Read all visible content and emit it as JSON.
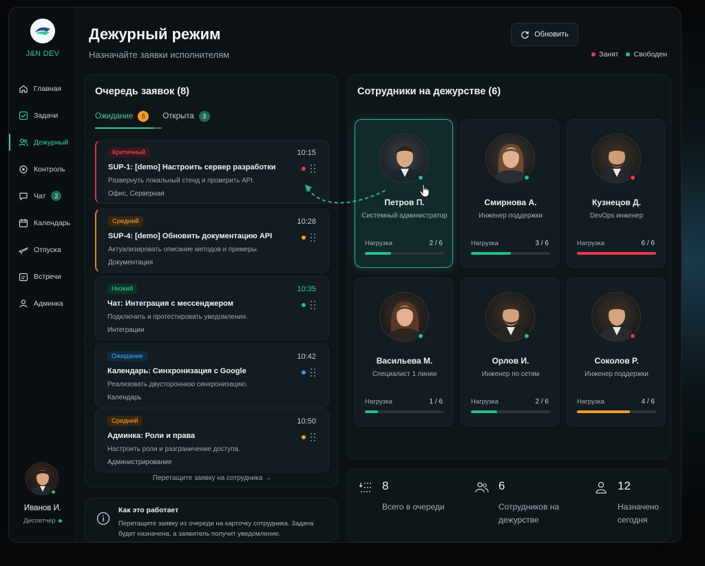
{
  "app": {
    "logo_text": "J&N DEV",
    "title": "Дежурный режим",
    "subtitle": "Назначайте заявки исполнителям",
    "refresh_label": "Обновить"
  },
  "legend": {
    "busy": "Занят",
    "free": "Свободен"
  },
  "colors": {
    "accent": "#2fd0a0",
    "busy": "#e5394e",
    "free": "#22c08f",
    "warning": "#f29b26",
    "info": "#3a9ae8"
  },
  "nav": [
    {
      "label": "Главная",
      "icon": "home-icon"
    },
    {
      "label": "Задачи",
      "icon": "checkbox-icon"
    },
    {
      "label": "Дежурный",
      "icon": "users-icon",
      "active": true
    },
    {
      "label": "Контроль",
      "icon": "control-icon"
    },
    {
      "label": "Чат",
      "icon": "chat-icon",
      "badge": "2"
    },
    {
      "label": "Календарь",
      "icon": "calendar-icon"
    },
    {
      "label": "Отпуска",
      "icon": "plane-icon"
    },
    {
      "label": "Встречи",
      "icon": "meeting-icon"
    },
    {
      "label": "Админка",
      "icon": "user-icon"
    }
  ],
  "user": {
    "name": "Иванов И.",
    "role": "Диспетчер"
  },
  "queue": {
    "title": "Очередь заявок (8)",
    "tabs": [
      {
        "label": "Ожидание",
        "badge": "5"
      },
      {
        "label": "Открыта",
        "badge": "3"
      }
    ],
    "tickets": [
      {
        "priority": "Критичный",
        "time": "10:15",
        "title": "SUP-1: [demo] Настроить сервер разработки",
        "desc": "Развернуть локальный стенд и проверить API.",
        "category": "Офис, Серверная"
      },
      {
        "priority": "Средний",
        "time": "10:28",
        "title": "SUP-4: [demo] Обновить документацию API",
        "desc": "Актуализировать описание методов и примеры.",
        "category": "Документация"
      },
      {
        "priority": "Низкий",
        "time": "10:35",
        "title": "Чат: Интеграция с мессенджером",
        "desc": "Подключить и протестировать уведомления.",
        "category": "Интеграции"
      },
      {
        "priority": "Ожидание",
        "time": "10:42",
        "title": "Календарь: Синхронизация с Google",
        "desc": "Реализовать двустороннюю синхронизацию.",
        "category": "Календарь"
      },
      {
        "priority": "Средний",
        "time": "10:50",
        "title": "Админка: Роли и права",
        "desc": "Настроить роли и разграничение доступа.",
        "category": "Администрирование"
      }
    ],
    "drag_hint": "Перетащите заявку на сотрудника →"
  },
  "howto": {
    "title": "Как это работает",
    "text": "Перетащите заявку из очереди на карточку сотрудника. Задача будет назначена, а заявитель получит уведомление."
  },
  "staff": {
    "title": "Сотрудники на дежурстве (6)",
    "load_label": "Нагрузка",
    "employees": [
      {
        "name": "Петров П.",
        "role": "Системный администратор",
        "load": "2 / 6",
        "load_value": 2,
        "load_max": 6,
        "status": "free"
      },
      {
        "name": "Смирнова А.",
        "role": "Инженер поддержки",
        "load": "3 / 6",
        "load_value": 3,
        "load_max": 6,
        "status": "free"
      },
      {
        "name": "Кузнецов Д.",
        "role": "DevOps инженер",
        "load": "6 / 6",
        "load_value": 6,
        "load_max": 6,
        "status": "busy"
      },
      {
        "name": "Васильева М.",
        "role": "Специалист 1 линии",
        "load": "1 / 6",
        "load_value": 1,
        "load_max": 6,
        "status": "free"
      },
      {
        "name": "Орлов И.",
        "role": "Инженер по сетям",
        "load": "2 / 6",
        "load_value": 2,
        "load_max": 6,
        "status": "free"
      },
      {
        "name": "Соколов Р.",
        "role": "Инженер поддержки",
        "load": "4 / 6",
        "load_value": 4,
        "load_max": 6,
        "status": "busy"
      }
    ]
  },
  "stats": [
    {
      "value": "8",
      "label": "Всего в очереди"
    },
    {
      "value": "6",
      "label": "Сотрудников на дежурстве"
    },
    {
      "value": "12",
      "label": "Назначено сегодня"
    }
  ]
}
